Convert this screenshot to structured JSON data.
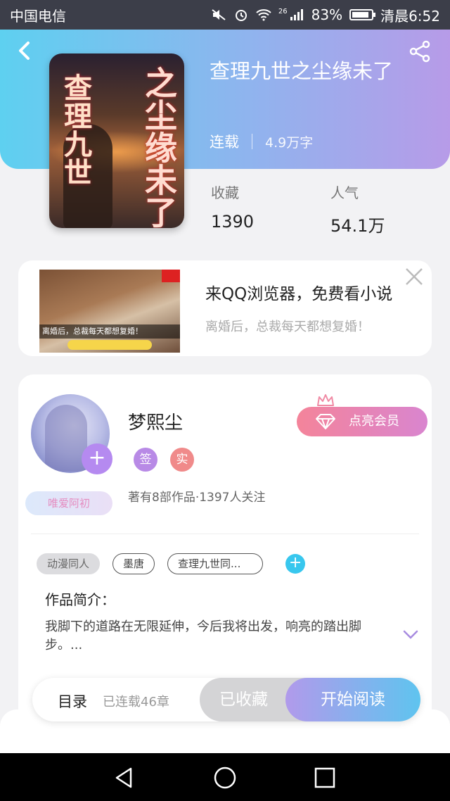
{
  "status_bar": {
    "carrier": "中国电信",
    "network": "26",
    "battery": "83%",
    "time": "清晨6:52",
    "icons": [
      "mute-icon",
      "alarm-icon",
      "wifi-icon",
      "signal-icon",
      "battery-icon"
    ]
  },
  "book": {
    "title": "查理九世之尘缘未了",
    "status": "连载",
    "word_count": "4.9万字",
    "cover_text_left": "查理九世",
    "cover_text_right": "之尘缘未了",
    "collections_label": "收藏",
    "collections_value": "1390",
    "popularity_label": "人气",
    "popularity_value": "54.1万"
  },
  "ad": {
    "title": "来QQ浏览器，免费看小说",
    "subtitle": "离婚后，总裁每天都想复婚！",
    "image_caption": "离婚后，总裁每天都想复婚！"
  },
  "author": {
    "name": "梦熙尘",
    "badge_sign": "签",
    "badge_real": "实",
    "stats": "著有8部作品·1397人关注",
    "fan_label": "唯爱阿初",
    "vip_label": "点亮会员",
    "colors": {
      "sign_badge": "#b88ae6",
      "real_badge": "#f08a8a"
    }
  },
  "tags": [
    "动漫同人",
    "墨唐",
    "查理九世同..."
  ],
  "intro": {
    "heading": "作品简介：",
    "text": "我脚下的道路在无限延伸，今后我将出发，响亮的踏出脚步。..."
  },
  "action_bar": {
    "toc_label": "目录",
    "chapter_status": "已连载46章",
    "collected_label": "已收藏",
    "read_label": "开始阅读"
  },
  "colors": {
    "header_start": "#5ed0f0",
    "header_end": "#b79be8",
    "accent_blue": "#38c7ee",
    "accent_purple": "#b58af0"
  }
}
